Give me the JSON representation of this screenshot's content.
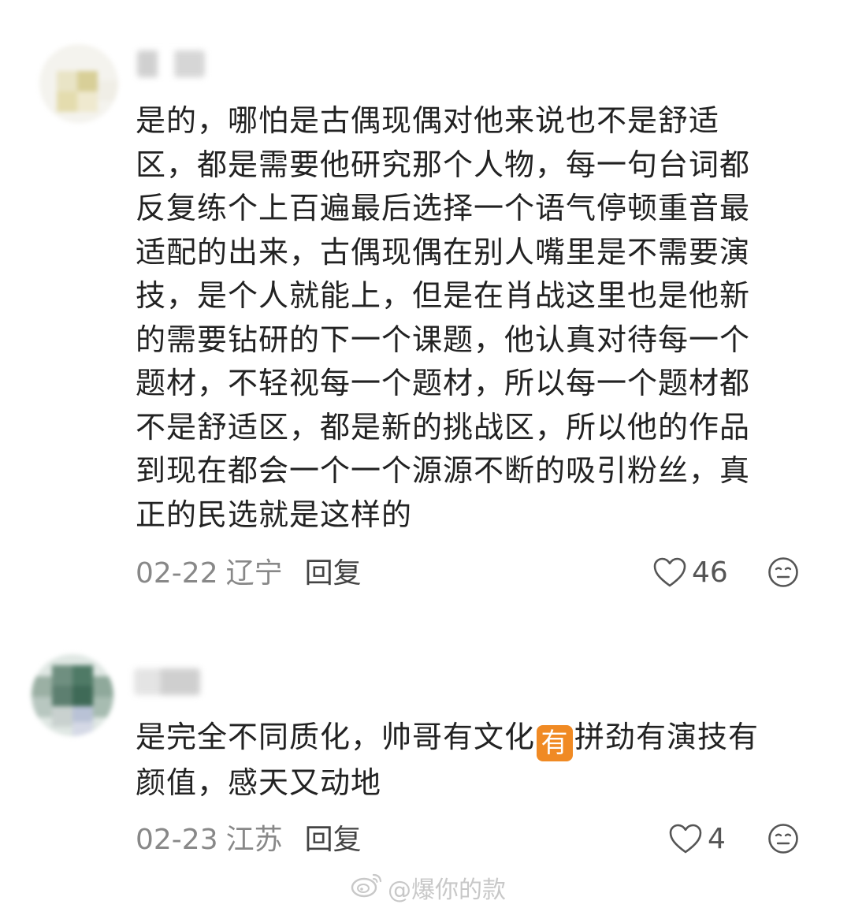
{
  "comments": [
    {
      "content_lines": [
        "是的，哪怕是古偶现偶对他来说也不是舒适",
        "区，都是需要他研究那个人物，每一句台词都",
        "反复练个上百遍最后选择一个语气停顿重音最",
        "适配的出来，古偶现偶在别人嘴里是不需要演",
        "技，是个人就能上，但是在肖战这里也是他新",
        "的需要钻研的下一个课题，他认真对待每一个",
        "题材，不轻视每一个题材，所以每一个题材都",
        "不是舒适区，都是新的挑战区，所以他的作品",
        "到现在都会一个一个源源不断的吸引粉丝，真",
        "正的民选就是这样的"
      ],
      "date": "02-22",
      "location": "辽宁",
      "reply_label": "回复",
      "like_count": "46"
    },
    {
      "content_part1": "是完全不同质化，帅哥有文化",
      "emoji_text": "有",
      "content_part2": "拼劲有演技有",
      "content_line2": "颜值，感天又动地",
      "date": "02-23",
      "location": "江苏",
      "reply_label": "回复",
      "like_count": "4"
    }
  ],
  "watermark": {
    "text": "@爆你的款",
    "icon": "weibo-logo-icon"
  },
  "colors": {
    "text": "#222222",
    "meta": "#888888",
    "emoji_badge": "#f08a24",
    "watermark": "#c8c8c8"
  }
}
